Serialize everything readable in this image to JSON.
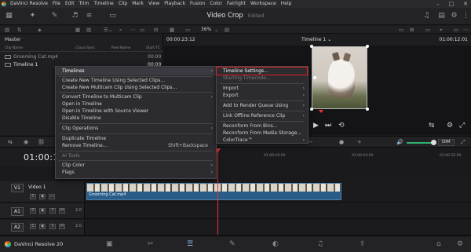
{
  "menubar": {
    "items": [
      "DaVinci Resolve",
      "File",
      "Edit",
      "Trim",
      "Timeline",
      "Clip",
      "Mark",
      "View",
      "Playback",
      "Fusion",
      "Color",
      "Fairlight",
      "Workspace",
      "Help"
    ],
    "window_controls": [
      "–",
      "□",
      "✕"
    ]
  },
  "toolbar": {
    "project_title": "Video Crop",
    "edited": "Edited"
  },
  "toolbar2": {
    "zoom": "36%"
  },
  "media_pool": {
    "bin": "Master",
    "columns": [
      "Clip Name",
      "Cloud Sync",
      "Reel Name",
      "Start TC"
    ],
    "clips": [
      {
        "name": "Grooming Cat.mp4",
        "tc": "00:00"
      },
      {
        "name": "Timeline 1",
        "tc": "00:00"
      }
    ]
  },
  "viewer": {
    "timecode": "00:00:23:12",
    "timeline_name": "Timeline 1",
    "timeline_name_suffix": "⌄",
    "end_tc": "01:00:12:01"
  },
  "timeline_toolbar": {
    "dim": "DIM"
  },
  "timeline": {
    "timecode": "01:00:12",
    "ruler_ticks": [
      "01:00:16:00",
      "01:00:24:00",
      "01:00:32:00"
    ],
    "tracks": [
      {
        "label": "V1",
        "name": "Video 1",
        "clip": "Grooming Cat.mp4"
      },
      {
        "label": "A1",
        "vol": "2.0"
      },
      {
        "label": "A2",
        "vol": "2.0"
      }
    ],
    "track_buttons": [
      "S",
      "M"
    ]
  },
  "context_menu_left": {
    "items": [
      {
        "label": "Timelines",
        "submenu": true
      },
      {
        "label": "Create New Timeline Using Selected Clips..."
      },
      {
        "label": "Create New Multicam Clip Using Selected Clips..."
      },
      {
        "label": "Convert Timeline to Multicam Clip",
        "submenu": true
      },
      {
        "label": "Open in Timeline"
      },
      {
        "label": "Open in Timeline with Source Viewer"
      },
      {
        "label": "Disable Timeline"
      },
      {
        "label": "Clip Operations",
        "submenu": true
      },
      {
        "label": "Duplicate Timeline"
      },
      {
        "label": "Remove Timeline...",
        "shortcut": "Shift+Backspace"
      },
      {
        "label": "AI Tools",
        "disabled": true
      },
      {
        "label": "Clip Color",
        "submenu": true
      },
      {
        "label": "Flags",
        "submenu": true
      }
    ]
  },
  "context_menu_right": {
    "items": [
      {
        "label": "Timeline Settings..."
      },
      {
        "label": "Starting Timecode...",
        "disabled": true
      },
      {
        "label": "Import",
        "submenu": true
      },
      {
        "label": "Export",
        "submenu": true
      },
      {
        "label": "Add to Render Queue Using",
        "submenu": true
      },
      {
        "label": "Link Offline Reference Clip",
        "submenu": true
      },
      {
        "label": "Reconform From Bins..."
      },
      {
        "label": "Reconform From Media Storage..."
      },
      {
        "label": "ColorTrace™",
        "submenu": true
      }
    ]
  },
  "bottombar": {
    "brand": "DaVinci Resolve 20"
  },
  "colors": {
    "accent": "#2a5c87",
    "playhead": "#e33333",
    "highlight_box": "#e02020",
    "level": "#2fb26b"
  }
}
